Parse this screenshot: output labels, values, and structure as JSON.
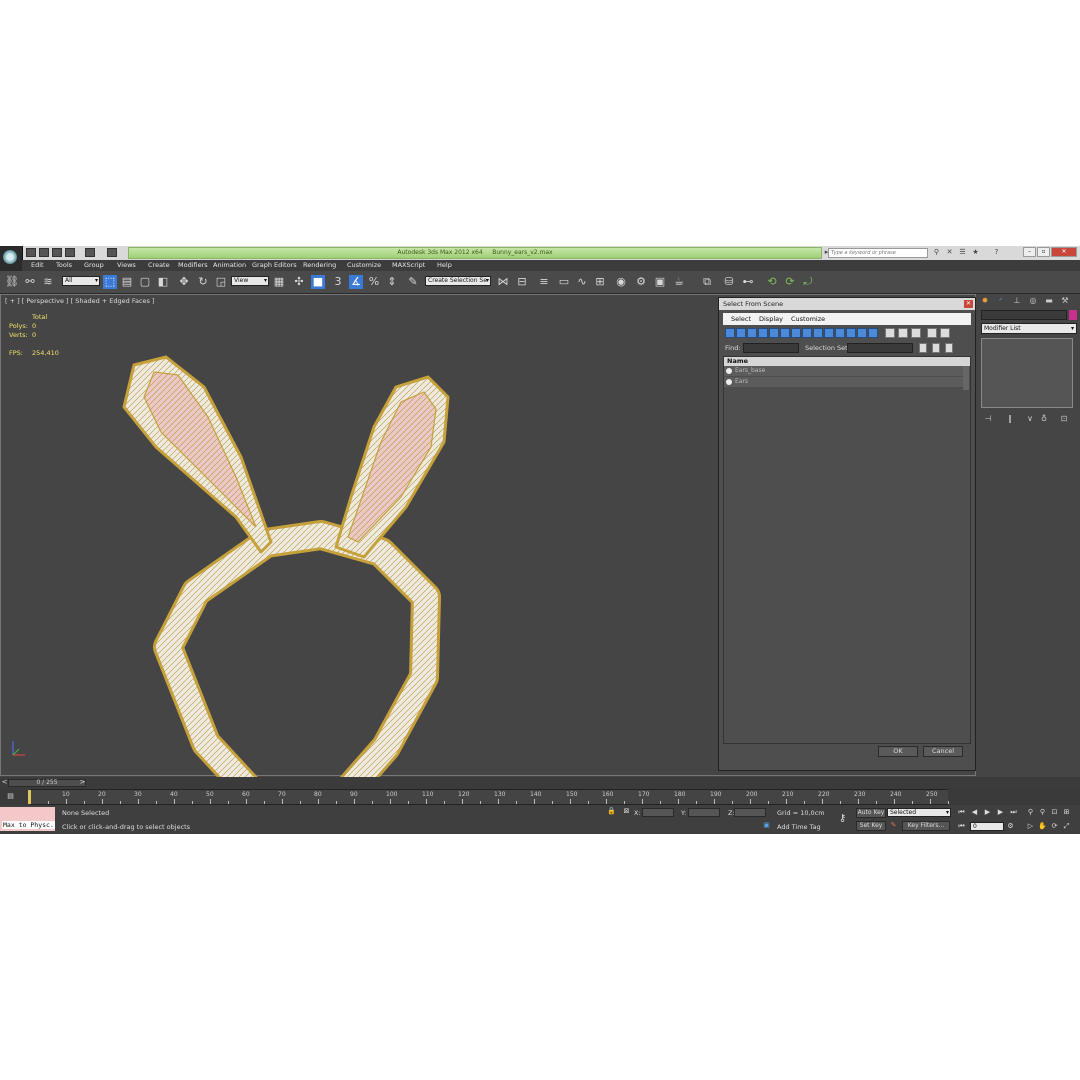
{
  "title": {
    "app": "Autodesk 3ds Max 2012 x64",
    "file": "Bunny_ears_v2.max"
  },
  "search": {
    "placeholder": "Type a keyword or phrase"
  },
  "menu": [
    "Edit",
    "Tools",
    "Group",
    "Views",
    "Create",
    "Modifiers",
    "Animation",
    "Graph Editors",
    "Rendering",
    "Customize",
    "MAXScript",
    "Help"
  ],
  "toolbar": {
    "filter": "All",
    "ref_coord": "View",
    "selection_set": "Create Selection Se",
    "snap_label": "3"
  },
  "viewport": {
    "label": "[ + ] [ Perspective ] [ Shaded + Edged Faces ]",
    "stats_header": "Total",
    "polys_label": "Polys:",
    "polys": "0",
    "verts_label": "Verts:",
    "verts": "0",
    "fps_label": "FPS:",
    "fps": "254,410"
  },
  "dialog": {
    "title": "Select From Scene",
    "menu": [
      "Select",
      "Display",
      "Customize"
    ],
    "find_label": "Find:",
    "selection_set_label": "Selection Set:",
    "column": "Name",
    "objects": [
      "Ears_base",
      "Ears"
    ],
    "ok": "OK",
    "cancel": "Cancel"
  },
  "command_panel": {
    "modifier_list": "Modifier List"
  },
  "timeline": {
    "slider": "0 / 255",
    "ticks": [
      "10",
      "20",
      "30",
      "40",
      "50",
      "60",
      "70",
      "80",
      "90",
      "100",
      "110",
      "120",
      "130",
      "140",
      "150",
      "160",
      "170",
      "180",
      "190",
      "200",
      "210",
      "220",
      "230",
      "240",
      "250"
    ]
  },
  "status": {
    "maxscript": "Max to Physc.",
    "selection": "None Selected",
    "prompt": "Click or click-and-drag to select objects",
    "x_label": "X:",
    "y_label": "Y:",
    "z_label": "Z:",
    "grid": "Grid = 10,0cm",
    "add_time_tag": "Add Time Tag",
    "auto_key": "Auto Key",
    "set_key": "Set Key",
    "key_mode": "Selected",
    "key_filters": "Key Filters...",
    "frame": "0"
  },
  "colors": {
    "title_green": "#a6d47f",
    "accent_blue": "#3b7ad6",
    "stats_yellow": "#f3e36b",
    "object_color": "#c8308f"
  }
}
